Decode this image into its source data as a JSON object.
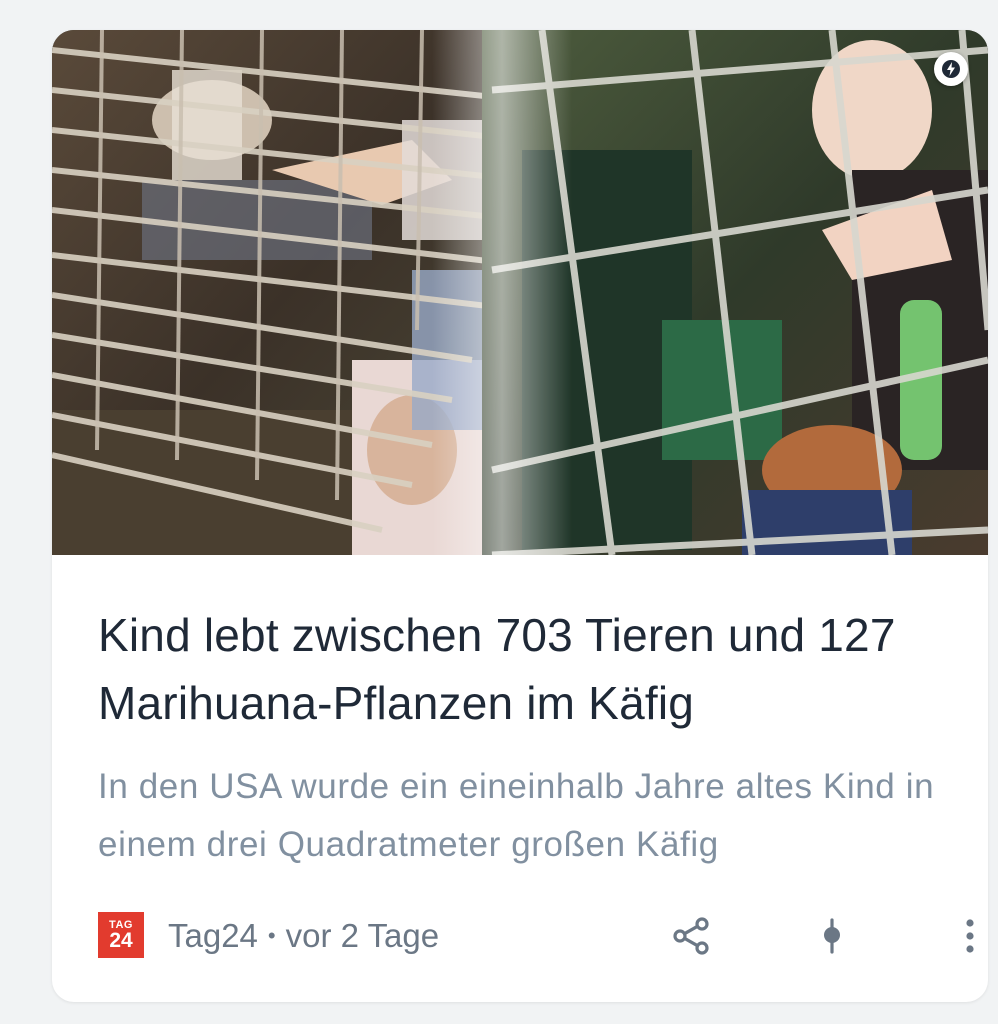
{
  "article": {
    "title": "Kind lebt zwischen 703 Tieren und 127 Marihuana-Pflanzen im Käfig",
    "snippet": "In den USA wurde ein eineinhalb Jahre altes Kind in einem drei Quadratmeter großen Käfig",
    "amp_icon": "lightning-bolt-icon",
    "image_alt": "Collage: Hand am Drahtkäfig mit Hund, Kind hinter Gitter"
  },
  "source": {
    "logo_line1": "TAG",
    "logo_line2": "24",
    "name": "Tag24",
    "separator": "•",
    "time": "vor 2 Tage",
    "logo_color": "#e23b2e"
  },
  "actions": {
    "share_icon": "share-icon",
    "pin_icon": "pin-icon",
    "more_icon": "more-vert-icon"
  },
  "colors": {
    "title": "#1f2937",
    "snippet": "#8190a0",
    "meta": "#6b7785",
    "icon": "#6b7785",
    "background": "#f1f3f4",
    "card": "#ffffff"
  }
}
